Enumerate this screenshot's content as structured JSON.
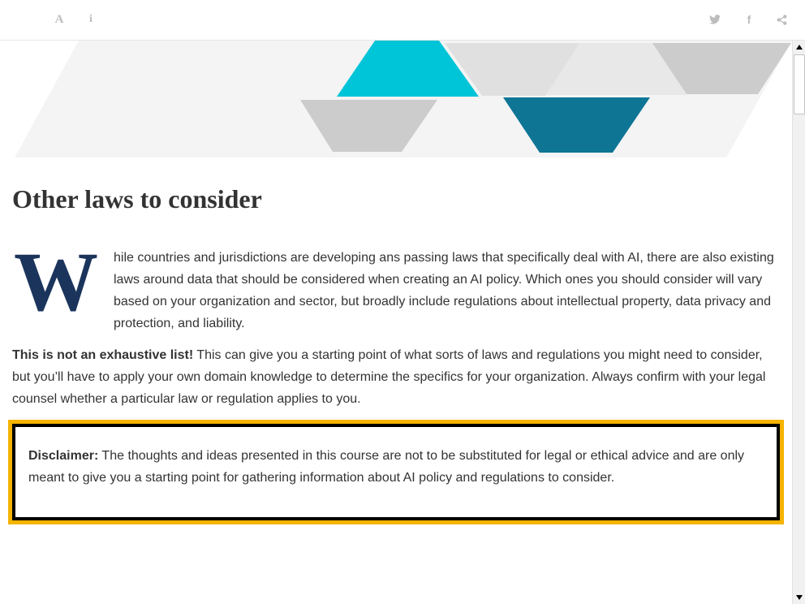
{
  "colors": {
    "dropcap": "#1b345c",
    "accent_border": "#f5b400",
    "hero_cyan": "#00c4d8",
    "hero_teal": "#0e7595",
    "hero_grey": "#cccccc",
    "hero_light": "#f4f4f4"
  },
  "toolbar": {
    "font_icon": "A",
    "info_icon": "i",
    "facebook_icon": "f"
  },
  "article": {
    "heading": "Other laws to consider",
    "p1_dropcap": "W",
    "p1_text": "hile countries and jurisdictions are developing ans passing laws that specifically deal with AI, there are also existing laws around data that should be considered when creating an AI policy. Which ones you should consider will vary based on your organization and sector, but broadly include regulations about intellectual property, data privacy and protection, and liability.",
    "p2_strong": "This is not an exhaustive list!",
    "p2_text": " This can give you a starting point of what sorts of laws and regulations you might need to consider, but you’ll have to apply your own domain knowledge to determine the specifics for your organization. Always confirm with your legal counsel whether a particular law or regulation applies to you."
  },
  "disclaimer": {
    "label": "Disclaimer:",
    "text": " The thoughts and ideas presented in this course are not to be substituted for legal or ethical advice and are only meant to give you a starting point for gathering information about AI policy and regulations to consider."
  }
}
